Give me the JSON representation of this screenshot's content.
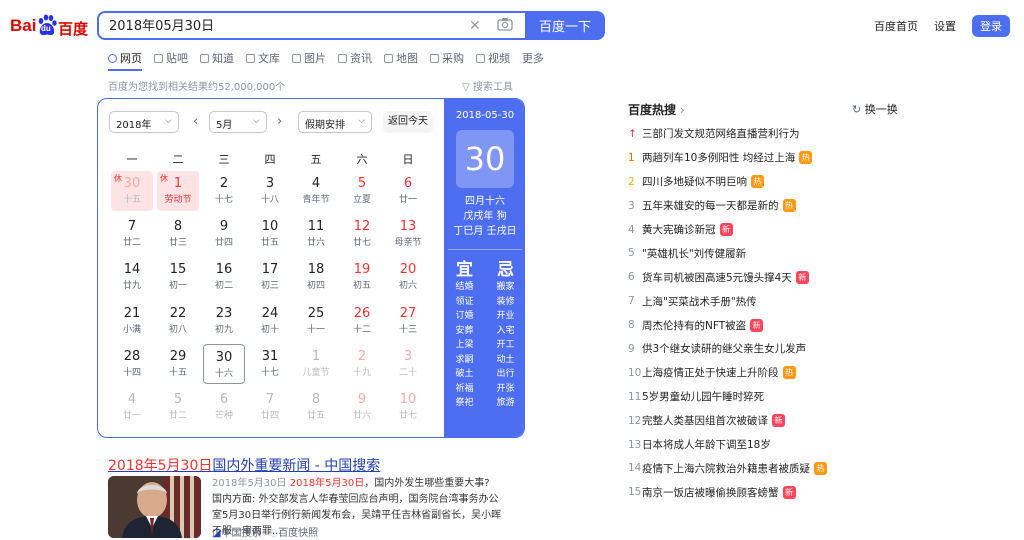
{
  "logo": {
    "text_bai": "Bai",
    "text_du": "du",
    "text_baidu": "百度"
  },
  "search": {
    "query": "2018年05月30日",
    "button_label": "百度一下"
  },
  "top_links": {
    "home": "百度首页",
    "settings": "设置",
    "login": "登录"
  },
  "tabs": [
    {
      "label": "网页"
    },
    {
      "label": "贴吧"
    },
    {
      "label": "知道"
    },
    {
      "label": "文库"
    },
    {
      "label": "图片"
    },
    {
      "label": "资讯"
    },
    {
      "label": "地图"
    },
    {
      "label": "采购"
    },
    {
      "label": "视频"
    },
    {
      "label": "更多"
    }
  ],
  "result_count": "百度为您找到相关结果约52,000,000个",
  "search_tools": "搜索工具",
  "calendar": {
    "year_select": "2018年",
    "month_select": "5月",
    "holiday_select": "假期安排",
    "today_button": "返回今天",
    "weekdays": [
      "一",
      "二",
      "三",
      "四",
      "五",
      "六",
      "日"
    ],
    "rows": [
      [
        {
          "n": "30",
          "l": "十五",
          "dim": true,
          "holiday": true,
          "xiu": "休"
        },
        {
          "n": "1",
          "l": "劳动节",
          "holiday": true,
          "xiu": "休"
        },
        {
          "n": "2",
          "l": "十七"
        },
        {
          "n": "3",
          "l": "十八"
        },
        {
          "n": "4",
          "l": "青年节"
        },
        {
          "n": "5",
          "l": "立夏",
          "red": true
        },
        {
          "n": "6",
          "l": "廿一",
          "red": true
        }
      ],
      [
        {
          "n": "7",
          "l": "廿二"
        },
        {
          "n": "8",
          "l": "廿三"
        },
        {
          "n": "9",
          "l": "廿四"
        },
        {
          "n": "10",
          "l": "廿五"
        },
        {
          "n": "11",
          "l": "廿六"
        },
        {
          "n": "12",
          "l": "廿七",
          "red": true
        },
        {
          "n": "13",
          "l": "母亲节",
          "red": true
        }
      ],
      [
        {
          "n": "14",
          "l": "廿九"
        },
        {
          "n": "15",
          "l": "初一"
        },
        {
          "n": "16",
          "l": "初二"
        },
        {
          "n": "17",
          "l": "初三"
        },
        {
          "n": "18",
          "l": "初四"
        },
        {
          "n": "19",
          "l": "初五",
          "red": true
        },
        {
          "n": "20",
          "l": "初六",
          "red": true
        }
      ],
      [
        {
          "n": "21",
          "l": "小满"
        },
        {
          "n": "22",
          "l": "初八"
        },
        {
          "n": "23",
          "l": "初九"
        },
        {
          "n": "24",
          "l": "初十"
        },
        {
          "n": "25",
          "l": "十一"
        },
        {
          "n": "26",
          "l": "十二",
          "red": true
        },
        {
          "n": "27",
          "l": "十三",
          "red": true
        }
      ],
      [
        {
          "n": "28",
          "l": "十四"
        },
        {
          "n": "29",
          "l": "十五"
        },
        {
          "n": "30",
          "l": "十六",
          "selected": true
        },
        {
          "n": "31",
          "l": "十七"
        },
        {
          "n": "1",
          "l": "儿童节",
          "dim": true
        },
        {
          "n": "2",
          "l": "十九",
          "dim": true,
          "red": true
        },
        {
          "n": "3",
          "l": "二十",
          "dim": true,
          "red": true
        }
      ],
      [
        {
          "n": "4",
          "l": "廿一",
          "dim": true
        },
        {
          "n": "5",
          "l": "廿二",
          "dim": true
        },
        {
          "n": "6",
          "l": "芒种",
          "dim": true
        },
        {
          "n": "7",
          "l": "廿四",
          "dim": true
        },
        {
          "n": "8",
          "l": "廿五",
          "dim": true
        },
        {
          "n": "9",
          "l": "廿六",
          "dim": true,
          "red": true
        },
        {
          "n": "10",
          "l": "廿七",
          "dim": true,
          "red": true
        }
      ]
    ],
    "detail": {
      "date": "2018-05-30",
      "day": "30",
      "lunar_lines": [
        "四月十六",
        "戊戌年 狗",
        "丁巳月 壬戌日"
      ],
      "yi_label": "宜",
      "ji_label": "忌",
      "yi_items": [
        "结婚",
        "领证",
        "订婚",
        "安葬",
        "上梁",
        "求嗣",
        "破土",
        "祈福",
        "祭祀"
      ],
      "ji_items": [
        "搬家",
        "装修",
        "开业",
        "入宅",
        "开工",
        "动土",
        "出行",
        "开张",
        "旅游"
      ]
    }
  },
  "news": {
    "title_hl": "2018年5月30日",
    "title_rest": "国内外重要新闻 - 中国搜索",
    "date": "2018年5月30日",
    "snippet_hl": "2018年5月30日",
    "snippet_a": "，国内外发生哪些重要大事? 国内方面: 外交部发言人华春莹回应台声明，国务院台湾事务办公室5月30日举行例行新闻发布会，吴靖平任吉林省副省长，吴小晖不服一审两罪...",
    "source": "中国搜索",
    "snapshot": "百度快照"
  },
  "hot": {
    "title": "百度热搜",
    "refresh": "换一换",
    "items": [
      {
        "rank": "↑",
        "text": "三部门发文规范网络直播营利行为",
        "badge": ""
      },
      {
        "rank": "1",
        "text": "两趟列车10多例阳性 均经过上海",
        "badge": "热"
      },
      {
        "rank": "2",
        "text": "四川多地疑似不明巨响",
        "badge": "热"
      },
      {
        "rank": "3",
        "text": "五年来雄安的每一天都是新的",
        "badge": "热"
      },
      {
        "rank": "4",
        "text": "黄大宪确诊新冠",
        "badge": "新"
      },
      {
        "rank": "5",
        "text": "\"英雄机长\"刘传健履新",
        "badge": ""
      },
      {
        "rank": "6",
        "text": "货车司机被困高速5元馒头撑4天",
        "badge": "新"
      },
      {
        "rank": "7",
        "text": "上海\"买菜战术手册\"热传",
        "badge": ""
      },
      {
        "rank": "8",
        "text": "周杰伦持有的NFT被盗",
        "badge": "新"
      },
      {
        "rank": "9",
        "text": "供3个继女读研的继父亲生女儿发声",
        "badge": ""
      },
      {
        "rank": "10",
        "text": "上海疫情正处于快速上升阶段",
        "badge": "热"
      },
      {
        "rank": "11",
        "text": "5岁男童幼儿园午睡时猝死",
        "badge": ""
      },
      {
        "rank": "12",
        "text": "完整人类基因组首次被破译",
        "badge": "新"
      },
      {
        "rank": "13",
        "text": "日本将成人年龄下调至18岁",
        "badge": ""
      },
      {
        "rank": "14",
        "text": "疫情下上海六院救治外籍患者被质疑",
        "badge": "热"
      },
      {
        "rank": "15",
        "text": "南京一饭店被曝偷换顾客螃蟹",
        "badge": "新"
      }
    ]
  }
}
